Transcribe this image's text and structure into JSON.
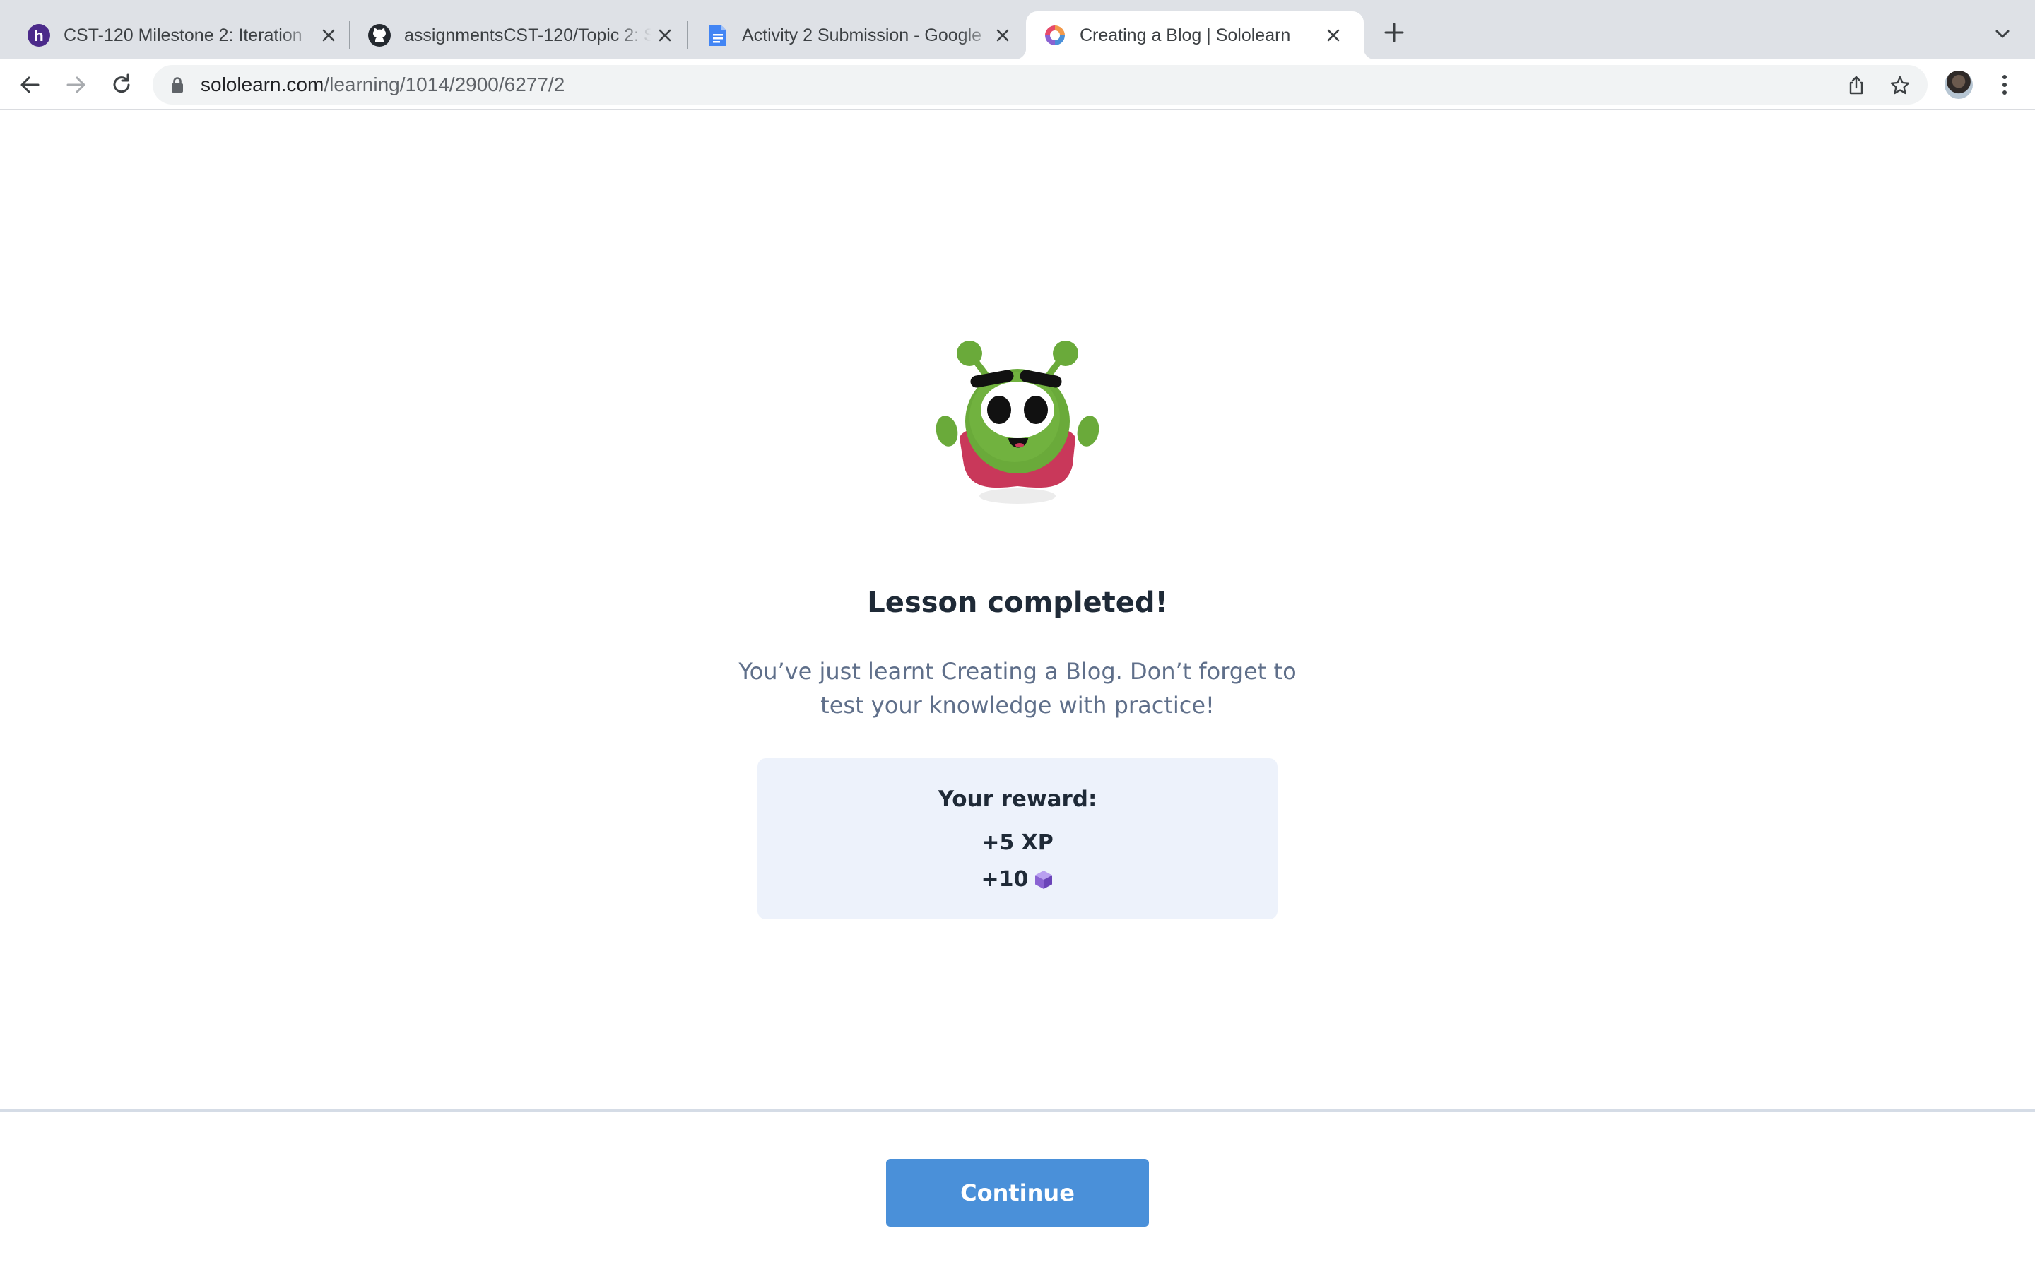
{
  "browser": {
    "tabs": [
      {
        "title": "CST-120 Milestone 2: Iteration",
        "favicon": "halo-icon"
      },
      {
        "title": "assignmentsCST-120/Topic 2: S",
        "favicon": "github-icon"
      },
      {
        "title": "Activity 2 Submission - Google",
        "favicon": "google-docs-icon"
      },
      {
        "title": "Creating a Blog | Sololearn",
        "favicon": "sololearn-icon",
        "active": true
      }
    ],
    "address": {
      "domain": "sololearn.com",
      "path": "/learning/1014/2900/6277/2"
    }
  },
  "lesson": {
    "headline": "Lesson completed!",
    "message": "You’ve just learnt Creating a Blog. Don’t forget to test your knowledge with practice!",
    "reward": {
      "title": "Your reward:",
      "xp": "+5 XP",
      "gems": "+10"
    },
    "continue_label": "Continue"
  },
  "colors": {
    "accent": "#4a90d9",
    "card_bg": "#edf2fb",
    "mascot_green": "#6aaa3a",
    "mascot_cape": "#c9385a",
    "gem": "#8a63d2"
  }
}
